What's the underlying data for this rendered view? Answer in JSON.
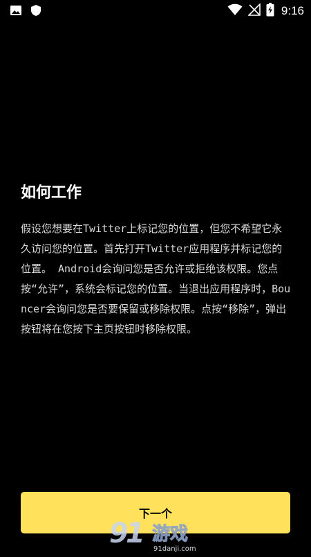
{
  "status_bar": {
    "time": "9:16",
    "icons_left": [
      "image-icon",
      "shield-icon"
    ],
    "icons_right": [
      "wifi-icon",
      "no-signal-icon",
      "battery-charging-icon"
    ]
  },
  "main": {
    "title": "如何工作",
    "body": "假设您想要在Twitter上标记您的位置，但您不希望它永久访问您的位置。首先打开Twitter应用程序并标记您的位置。 Android会询问您是否允许或拒绝该权限。您点按“允许”，系统会标记您的位置。当退出应用程序时，Bouncer会询问您是否要保留或移除权限。点按“移除”，弹出按钮将在您按下主页按钮时移除权限。"
  },
  "footer": {
    "next_label": "下一个"
  },
  "watermark": {
    "logo": "91游戏",
    "url": "91danji.com"
  },
  "colors": {
    "background": "#000000",
    "accent": "#ffe15b",
    "text": "#ffffff"
  }
}
